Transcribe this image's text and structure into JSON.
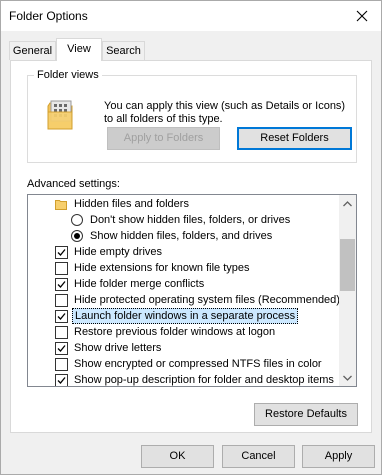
{
  "window": {
    "title": "Folder Options"
  },
  "tabs": [
    {
      "label": "General",
      "active": false
    },
    {
      "label": "View",
      "active": true
    },
    {
      "label": "Search",
      "active": false
    }
  ],
  "folder_views": {
    "legend": "Folder views",
    "description": "You can apply this view (such as Details or Icons) to all folders of this type.",
    "apply_label": "Apply to Folders",
    "reset_label": "Reset Folders"
  },
  "advanced": {
    "label": "Advanced settings:",
    "items": [
      {
        "kind": "folder",
        "label": "Hidden files and folders"
      },
      {
        "kind": "radio",
        "checked": false,
        "label": "Don't show hidden files, folders, or drives"
      },
      {
        "kind": "radio",
        "checked": true,
        "label": "Show hidden files, folders, and drives"
      },
      {
        "kind": "check",
        "checked": true,
        "label": "Hide empty drives"
      },
      {
        "kind": "check",
        "checked": false,
        "label": "Hide extensions for known file types"
      },
      {
        "kind": "check",
        "checked": true,
        "label": "Hide folder merge conflicts"
      },
      {
        "kind": "check",
        "checked": false,
        "label": "Hide protected operating system files (Recommended)"
      },
      {
        "kind": "check",
        "checked": true,
        "selected": true,
        "label": "Launch folder windows in a separate process"
      },
      {
        "kind": "check",
        "checked": false,
        "label": "Restore previous folder windows at logon"
      },
      {
        "kind": "check",
        "checked": true,
        "label": "Show drive letters"
      },
      {
        "kind": "check",
        "checked": false,
        "label": "Show encrypted or compressed NTFS files in color"
      },
      {
        "kind": "check",
        "checked": true,
        "label": "Show pop-up description for folder and desktop items"
      }
    ],
    "restore_label": "Restore Defaults"
  },
  "footer": {
    "ok_label": "OK",
    "cancel_label": "Cancel",
    "apply_label": "Apply"
  }
}
